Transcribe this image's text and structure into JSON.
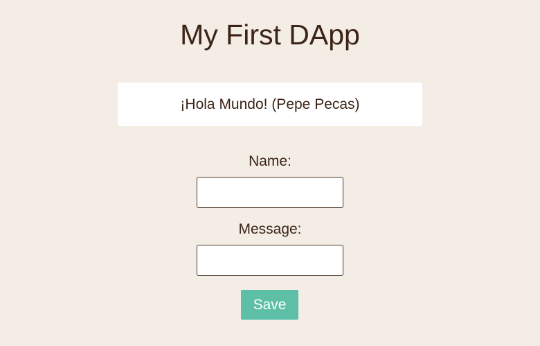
{
  "app": {
    "title": "My First DApp"
  },
  "message_card": {
    "text": "¡Hola Mundo! (Pepe Pecas)"
  },
  "form": {
    "name_label": "Name:",
    "name_value": "",
    "message_label": "Message:",
    "message_value": "",
    "save_label": "Save"
  },
  "colors": {
    "background": "#f3ede6",
    "text": "#3b2416",
    "card": "#ffffff",
    "button": "#5cbfa6",
    "button_text": "#ffffff",
    "input_border": "#4a3426"
  }
}
